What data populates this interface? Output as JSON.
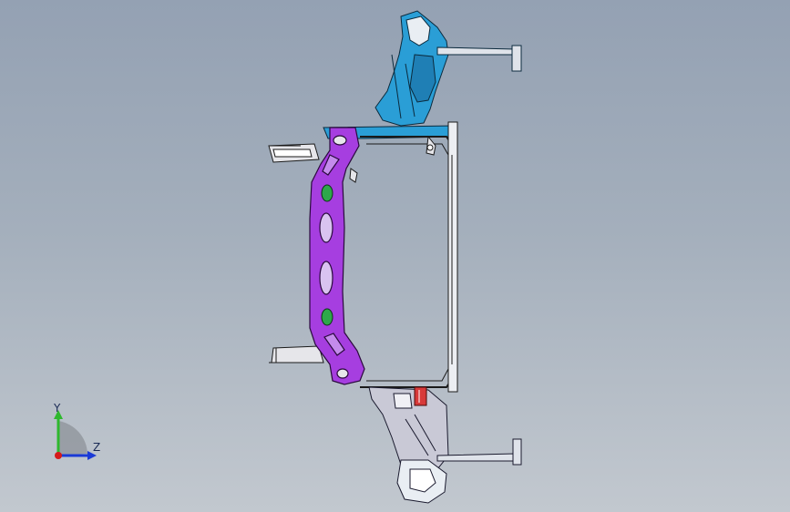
{
  "viewport": {
    "background_top": "#94a1b3",
    "background_bottom": "#c2c8cf"
  },
  "model": {
    "parts": [
      {
        "name": "upper-bracket",
        "color": "#2a9ed6"
      },
      {
        "name": "crossmember-beam",
        "color": "#a63ee0"
      },
      {
        "name": "radiator-frame",
        "color": "#e6e6ea"
      },
      {
        "name": "lower-bracket",
        "color": "#c9c9d6"
      },
      {
        "name": "mount-clip",
        "color": "#d83a3a"
      },
      {
        "name": "beam-grommet",
        "color": "#2ea84a"
      }
    ]
  },
  "triad": {
    "y_label": "Y",
    "z_label": "Z",
    "y_color": "#2eb82e",
    "z_color": "#1a3ad6",
    "x_color": "#d61a1a"
  }
}
